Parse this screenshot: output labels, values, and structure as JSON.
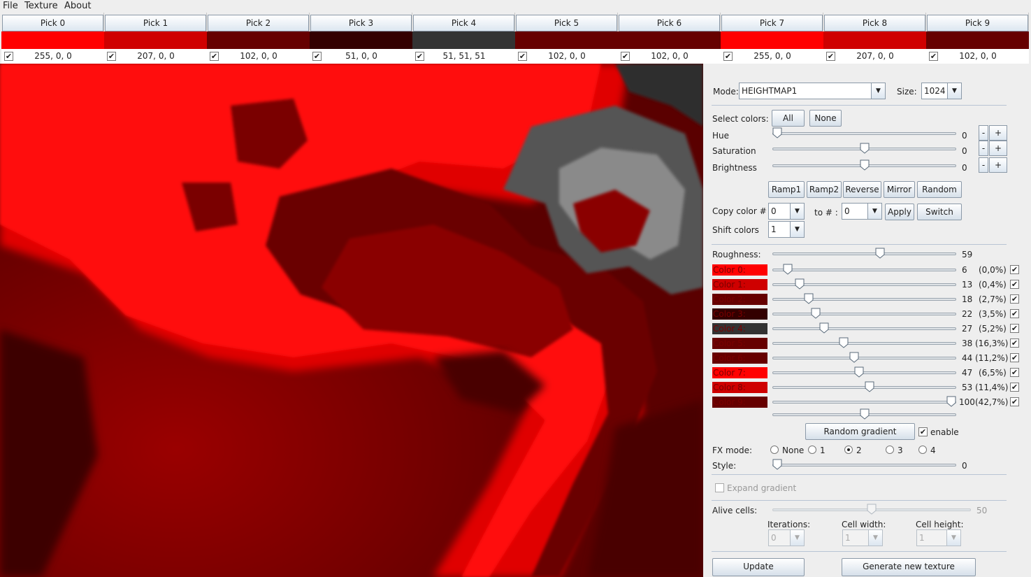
{
  "menu": [
    "File",
    "Texture",
    "About"
  ],
  "picks": [
    {
      "label": "Pick 0",
      "value": "255, 0, 0",
      "color": "#ff0000"
    },
    {
      "label": "Pick 1",
      "value": "207, 0, 0",
      "color": "#cf0000"
    },
    {
      "label": "Pick 2",
      "value": "102, 0, 0",
      "color": "#660000"
    },
    {
      "label": "Pick 3",
      "value": "51, 0, 0",
      "color": "#330000"
    },
    {
      "label": "Pick 4",
      "value": "51, 51, 51",
      "color": "#333333"
    },
    {
      "label": "Pick 5",
      "value": "102, 0, 0",
      "color": "#660000"
    },
    {
      "label": "Pick 6",
      "value": "102, 0, 0",
      "color": "#660000"
    },
    {
      "label": "Pick 7",
      "value": "255, 0, 0",
      "color": "#ff0000"
    },
    {
      "label": "Pick 8",
      "value": "207, 0, 0",
      "color": "#cf0000"
    },
    {
      "label": "Pick 9",
      "value": "102, 0, 0",
      "color": "#660000"
    }
  ],
  "controls": {
    "mode_label": "Mode:",
    "mode_value": "HEIGHTMAP1",
    "size_label": "Size:",
    "size_value": "1024",
    "select_colors_label": "Select colors:",
    "all_button": "All",
    "none_button": "None",
    "hue_label": "Hue",
    "hue_value": "0",
    "saturation_label": "Saturation",
    "saturation_value": "0",
    "brightness_label": "Brightness",
    "brightness_value": "0",
    "minus": "-",
    "plus": "+",
    "ramp1": "Ramp1",
    "ramp2": "Ramp2",
    "reverse": "Reverse",
    "mirror": "Mirror",
    "random": "Random",
    "copy_color_label": "Copy color # :",
    "copy_from_value": "0",
    "to_label": "to # :",
    "copy_to_value": "0",
    "apply": "Apply",
    "switch": "Switch",
    "shift_colors_label": "Shift colors",
    "shift_value": "1",
    "roughness_label": "Roughness:",
    "roughness_value": "59",
    "random_gradient": "Random gradient",
    "enable_label": "enable",
    "fx_mode_label": "FX mode:",
    "fx_options": [
      "None",
      "1",
      "2",
      "3",
      "4"
    ],
    "fx_selected": "2",
    "style_label": "Style:",
    "style_value": "0",
    "expand_gradient": "Expand gradient",
    "alive_cells_label": "Alive cells:",
    "alive_cells_value": "50",
    "iterations_label": "Iterations:",
    "iterations_value": "0",
    "cell_width_label": "Cell width:",
    "cell_width_value": "1",
    "cell_height_label": "Cell height:",
    "cell_height_value": "1",
    "update": "Update",
    "generate": "Generate new texture"
  },
  "gradient_colors": [
    {
      "label": "Color 0:",
      "value": "6",
      "pct": "(0,0%)",
      "color": "#ff0000"
    },
    {
      "label": "Color 1:",
      "value": "13",
      "pct": "(0,4%)",
      "color": "#cf0000"
    },
    {
      "label": "Color 2:",
      "value": "18",
      "pct": "(2,7%)",
      "color": "#660000"
    },
    {
      "label": "Color 3:",
      "value": "22",
      "pct": "(3,5%)",
      "color": "#330000"
    },
    {
      "label": "Color 4:",
      "value": "27",
      "pct": "(5,2%)",
      "color": "#333333"
    },
    {
      "label": "Color 5:",
      "value": "38",
      "pct": "(16,3%)",
      "color": "#660000"
    },
    {
      "label": "Color 6:",
      "value": "44",
      "pct": "(11,2%)",
      "color": "#660000"
    },
    {
      "label": "Color 7:",
      "value": "47",
      "pct": "(6,5%)",
      "color": "#ff0000"
    },
    {
      "label": "Color 8:",
      "value": "53",
      "pct": "(11,4%)",
      "color": "#cf0000"
    },
    {
      "label": "Color 9:",
      "value": "100",
      "pct": "(42,7%)",
      "color": "#660000"
    }
  ]
}
